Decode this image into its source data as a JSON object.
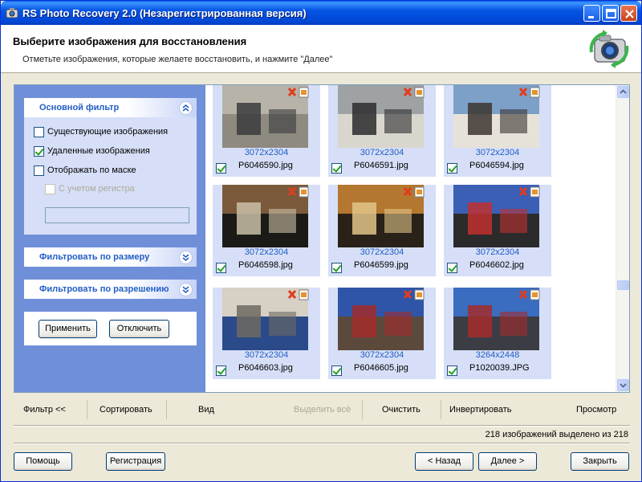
{
  "window": {
    "title": "RS Photo Recovery 2.0 (Незарегистрированная версия)"
  },
  "header": {
    "title": "Выберите изображения для восстановления",
    "subtitle": "Отметьте изображения, которые желаете восстановить, и нажмите \"Далее\""
  },
  "filter": {
    "main_group": {
      "title": "Основной фильтр",
      "options": [
        {
          "label": "Существующие изображения",
          "checked": false,
          "enabled": true
        },
        {
          "label": "Удаленные изображения",
          "checked": true,
          "enabled": true
        },
        {
          "label": "Отображать по маске",
          "checked": false,
          "enabled": true
        },
        {
          "label": "С учетом регистра",
          "checked": false,
          "enabled": false
        }
      ],
      "mask_value": ""
    },
    "size_group": {
      "title": "Фильтровать по размеру"
    },
    "resolution_group": {
      "title": "Фильтровать по разрешению"
    },
    "apply_label": "Применить",
    "disable_label": "Отключить"
  },
  "thumbnails": [
    {
      "resolution": "3072x2304",
      "filename": "P6046590.jpg",
      "checked": true,
      "colors": [
        "#b7b3a8",
        "#3b3b3d",
        "#8e8a80"
      ]
    },
    {
      "resolution": "3072x2304",
      "filename": "P6046591.jpg",
      "checked": true,
      "colors": [
        "#9ea2a2",
        "#2d2c2e",
        "#d8d6cd"
      ]
    },
    {
      "resolution": "3072x2304",
      "filename": "P6046594.jpg",
      "checked": true,
      "colors": [
        "#7da0c9",
        "#3b3430",
        "#e7e2d9"
      ]
    },
    {
      "resolution": "3072x2304",
      "filename": "P6046598.jpg",
      "checked": true,
      "colors": [
        "#7a5a3a",
        "#c9bfa8",
        "#1c1a16"
      ]
    },
    {
      "resolution": "3072x2304",
      "filename": "P6046599.jpg",
      "checked": true,
      "colors": [
        "#b3772f",
        "#e0c488",
        "#2a2118"
      ]
    },
    {
      "resolution": "3072x2304",
      "filename": "P6046602.jpg",
      "checked": true,
      "colors": [
        "#3a5fb5",
        "#c03030",
        "#2b2b2b"
      ]
    },
    {
      "resolution": "3072x2304",
      "filename": "P6046603.jpg",
      "checked": true,
      "colors": [
        "#d7d0c4",
        "#6f6a62",
        "#2a4a8a"
      ]
    },
    {
      "resolution": "3072x2304",
      "filename": "P6046605.jpg",
      "checked": true,
      "colors": [
        "#2e55a8",
        "#a32c2c",
        "#5b4a3c"
      ]
    },
    {
      "resolution": "3264x2448",
      "filename": "P1020039.JPG",
      "checked": true,
      "colors": [
        "#3a6cc0",
        "#a52b2b",
        "#3c3c44"
      ]
    }
  ],
  "toolbar": {
    "filter_label": "Фильтр <<",
    "sort_label": "Сортировать",
    "view_label": "Вид",
    "select_all_label": "Выделить всё",
    "clear_label": "Очистить",
    "invert_label": "Инвертировать",
    "preview_label": "Просмотр"
  },
  "status": "218 изображений выделено из 218",
  "footer": {
    "help_label": "Помощь",
    "register_label": "Регистрация",
    "back_label": "< Назад",
    "next_label": "Далее >",
    "close_label": "Закрыть"
  }
}
